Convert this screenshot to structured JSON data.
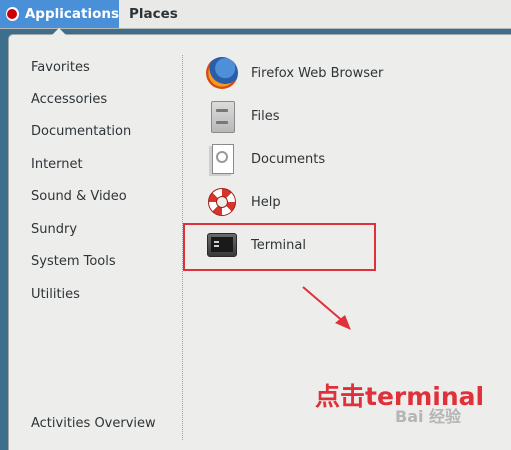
{
  "topbar": {
    "applications_label": "Applications",
    "places_label": "Places"
  },
  "categories": [
    {
      "label": "Favorites"
    },
    {
      "label": "Accessories"
    },
    {
      "label": "Documentation"
    },
    {
      "label": "Internet"
    },
    {
      "label": "Sound & Video"
    },
    {
      "label": "Sundry"
    },
    {
      "label": "System Tools"
    },
    {
      "label": "Utilities"
    }
  ],
  "apps": [
    {
      "label": "Firefox Web Browser",
      "icon": "firefox-icon"
    },
    {
      "label": "Files",
      "icon": "files-cabinet-icon"
    },
    {
      "label": "Documents",
      "icon": "documents-icon"
    },
    {
      "label": "Help",
      "icon": "help-lifebuoy-icon"
    },
    {
      "label": "Terminal",
      "icon": "terminal-icon"
    }
  ],
  "activities_overview_label": "Activities Overview",
  "annotation": {
    "text": "点击terminal",
    "color": "#e0313a"
  },
  "watermark": "Bai 经验",
  "colors": {
    "accent": "#4a90d9",
    "desktop": "#3b6f8d",
    "annotation": "#e0313a"
  }
}
